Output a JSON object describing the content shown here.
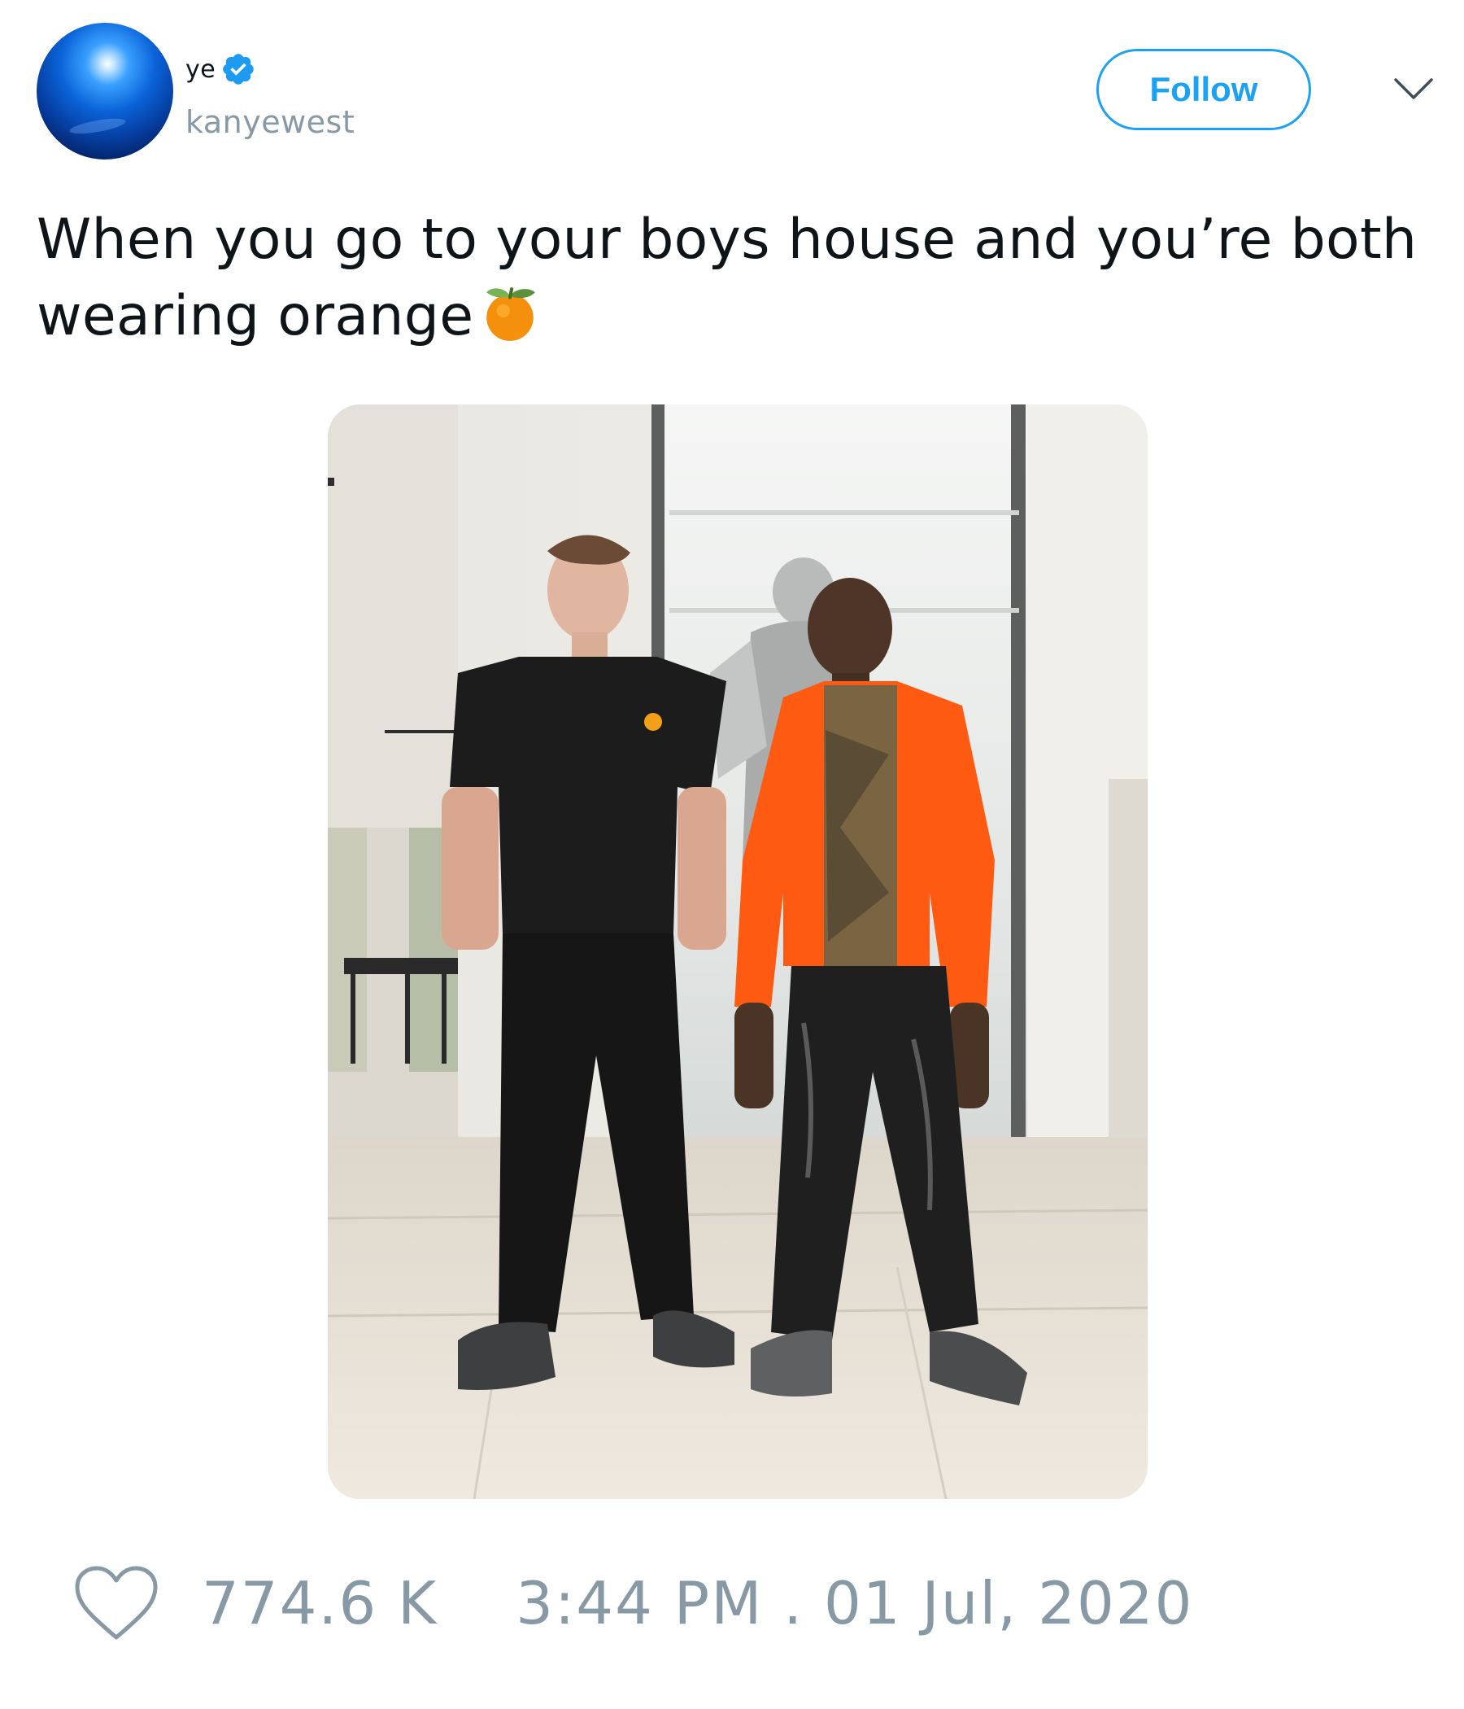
{
  "author": {
    "display_name": "ye",
    "handle": "kanyewest",
    "verified": true,
    "avatar_icon": "blue-globe-avatar"
  },
  "actions": {
    "follow_label": "Follow",
    "menu_icon": "chevron-down-icon"
  },
  "tweet": {
    "text": "When you go to your boys house and you’re both wearing orange",
    "emoji": "tangerine-emoji",
    "media": {
      "type": "photo",
      "icon": "photo"
    }
  },
  "footer": {
    "like_icon": "heart-icon",
    "like_count": "774.6 K",
    "timestamp": "3:44 PM . 01 Jul, 2020"
  },
  "colors": {
    "accent": "#1da1f2",
    "muted": "#8899a6",
    "text": "#0f1419",
    "verified": "#1d9bf0"
  }
}
